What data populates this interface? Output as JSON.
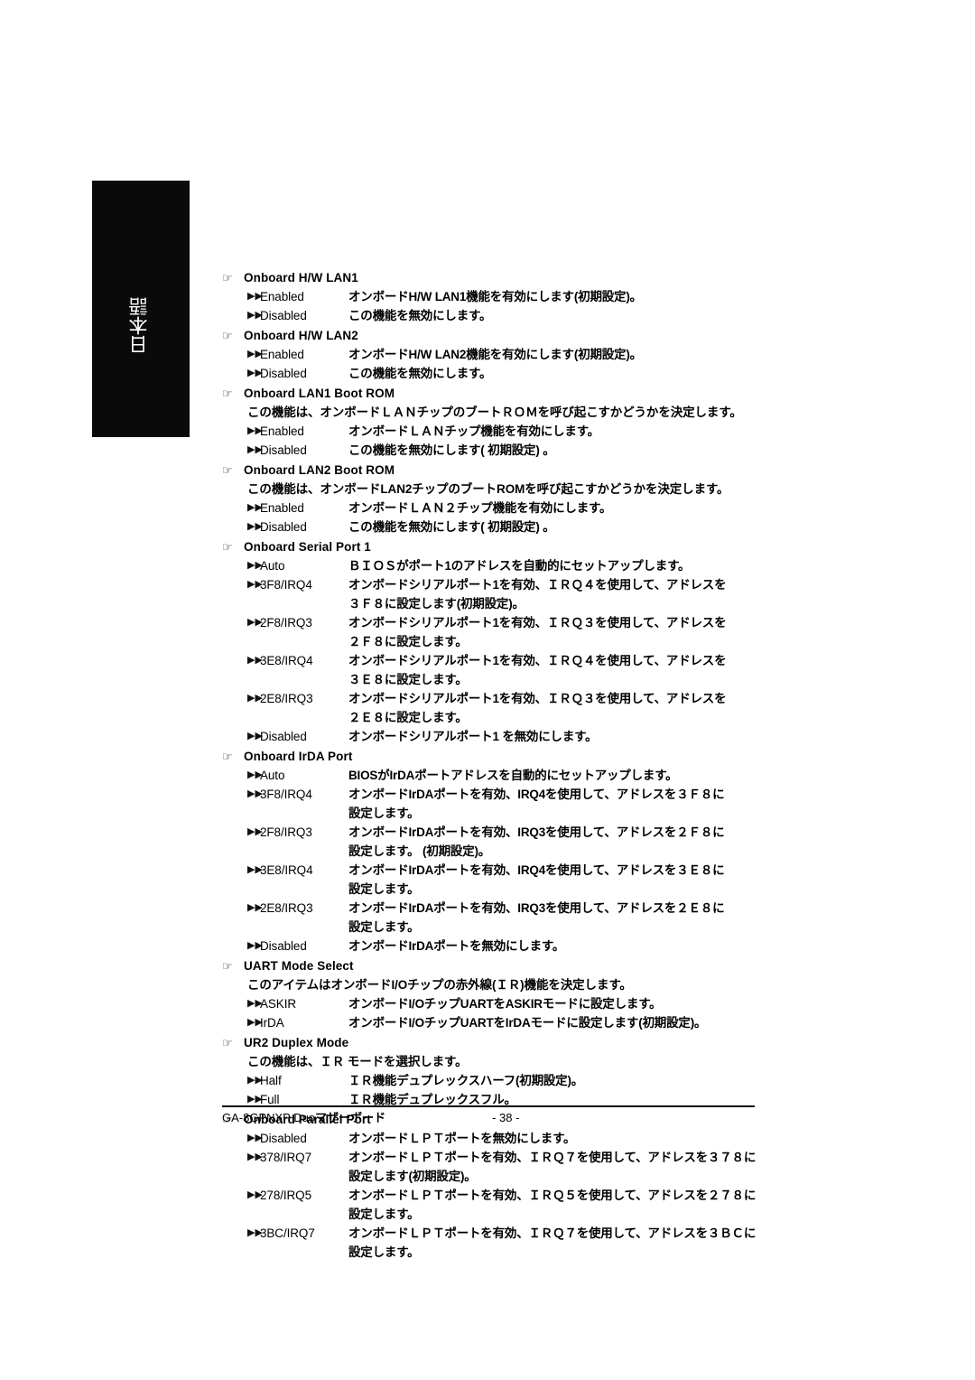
{
  "language_tab": {
    "label": "日本語"
  },
  "icons": {
    "heading_bullet": "☞",
    "option_bullet": "▶▶"
  },
  "sections": [
    {
      "title": "Onboard H/W LAN1",
      "intro": null,
      "options": [
        {
          "label": "Enabled",
          "desc": "オンボードH/W LAN1機能を有効にします(初期設定)。",
          "cont": null
        },
        {
          "label": "Disabled",
          "desc": "この機能を無効にします。",
          "cont": null
        }
      ]
    },
    {
      "title": "Onboard H/W LAN2",
      "intro": null,
      "options": [
        {
          "label": "Enabled",
          "desc": "オンボードH/W LAN2機能を有効にします(初期設定)。",
          "cont": null
        },
        {
          "label": "Disabled",
          "desc": "この機能を無効にします。",
          "cont": null
        }
      ]
    },
    {
      "title": "Onboard LAN1 Boot ROM",
      "intro": "この機能は、オンボードＬＡＮチップのブートＲＯＭを呼び起こすかどうかを決定します。",
      "options": [
        {
          "label": "Enabled",
          "desc": "オンボードＬＡＮチップ機能を有効にします。",
          "cont": null
        },
        {
          "label": "Disabled",
          "desc": "この機能を無効にします( 初期設定) 。",
          "cont": null
        }
      ]
    },
    {
      "title": "Onboard LAN2 Boot ROM",
      "intro": "この機能は、オンボードLAN2チップのブートROMを呼び起こすかどうかを決定します。",
      "options": [
        {
          "label": "Enabled",
          "desc": "オンボードＬＡＮ２チップ機能を有効にします。",
          "cont": null
        },
        {
          "label": "Disabled",
          "desc": "この機能を無効にします( 初期設定) 。",
          "cont": null
        }
      ]
    },
    {
      "title": "Onboard Serial Port 1",
      "intro": null,
      "options": [
        {
          "label": "Auto",
          "desc": "ＢＩＯＳがポート1のアドレスを自動的にセットアップします。",
          "cont": null
        },
        {
          "label": "3F8/IRQ4",
          "desc": "オンボードシリアルポート1を有効、ＩＲＱ４を使用して、アドレスを",
          "cont": "３Ｆ８に設定します(初期設定)。"
        },
        {
          "label": "2F8/IRQ3",
          "desc": "オンボードシリアルポート1を有効、ＩＲＱ３を使用して、アドレスを",
          "cont": "２Ｆ８に設定します。"
        },
        {
          "label": "3E8/IRQ4",
          "desc": "オンボードシリアルポート1を有効、ＩＲＱ４を使用して、アドレスを",
          "cont": "３Ｅ８に設定します。"
        },
        {
          "label": "2E8/IRQ3",
          "desc": "オンボードシリアルポート1を有効、ＩＲＱ３を使用して、アドレスを",
          "cont": "２Ｅ８に設定します。"
        },
        {
          "label": "Disabled",
          "desc": "オンボードシリアルポート1 を無効にします。",
          "cont": null
        }
      ]
    },
    {
      "title": "Onboard IrDA Port",
      "intro": null,
      "options": [
        {
          "label": "Auto",
          "desc": "BIOSがIrDAポートアドレスを自動的にセットアップします。",
          "cont": null
        },
        {
          "label": "3F8/IRQ4",
          "desc": "オンボードIrDAポートを有効、IRQ4を使用して、アドレスを３Ｆ８に",
          "cont": "設定します。"
        },
        {
          "label": "2F8/IRQ3",
          "desc": "オンボードIrDAポートを有効、IRQ3を使用して、アドレスを２Ｆ８に",
          "cont": "設定します。 (初期設定)。"
        },
        {
          "label": "3E8/IRQ4",
          "desc": "オンボードIrDAポートを有効、IRQ4を使用して、アドレスを３Ｅ８に",
          "cont": "設定します。"
        },
        {
          "label": "2E8/IRQ3",
          "desc": "オンボードIrDAポートを有効、IRQ3を使用して、アドレスを２Ｅ８に",
          "cont": "設定します。"
        },
        {
          "label": "Disabled",
          "desc": "オンボードIrDAポートを無効にします。",
          "cont": null
        }
      ]
    },
    {
      "title": "UART Mode Select",
      "intro": "このアイテムはオンボードI/Oチップの赤外線(ＩＲ)機能を決定します。",
      "options": [
        {
          "label": "ASKIR",
          "desc": "オンボードI/OチップUARTをASKIRモードに設定します。",
          "cont": null
        },
        {
          "label": "IrDA",
          "desc": "オンボードI/OチップUARTをIrDAモードに設定します(初期設定)。",
          "cont": null
        }
      ]
    },
    {
      "title": "UR2 Duplex Mode",
      "intro": "この機能は、ＩＲ モードを選択します。",
      "options": [
        {
          "label": "Half",
          "desc": "ＩＲ機能デュプレックスハーフ(初期設定)。",
          "cont": null
        },
        {
          "label": "Full",
          "desc": "ＩＲ機能デュプレックスフル。",
          "cont": null
        }
      ]
    },
    {
      "title": "Onboard Parallel Port",
      "intro": null,
      "options": [
        {
          "label": "Disabled",
          "desc": "オンボードＬＰＴポートを無効にします。",
          "cont": null
        },
        {
          "label": "378/IRQ7",
          "desc": "オンボードＬＰＴポートを有効、ＩＲＱ７を使用して、アドレスを３７８に",
          "cont": "設定します(初期設定)。"
        },
        {
          "label": "278/IRQ5",
          "desc": "オンボードＬＰＴポートを有効、ＩＲＱ５を使用して、アドレスを２７８に",
          "cont": "設定します。"
        },
        {
          "label": "3BC/IRQ7",
          "desc": "オンボードＬＰＴポートを有効、ＩＲＱ７を使用して、アドレスを３ＢＣに",
          "cont": "設定します。"
        }
      ]
    }
  ],
  "footer": {
    "product": "GA-8GPNXP Duo",
    "product_suffix": "マザーボード",
    "page_number": "- 38 -"
  }
}
